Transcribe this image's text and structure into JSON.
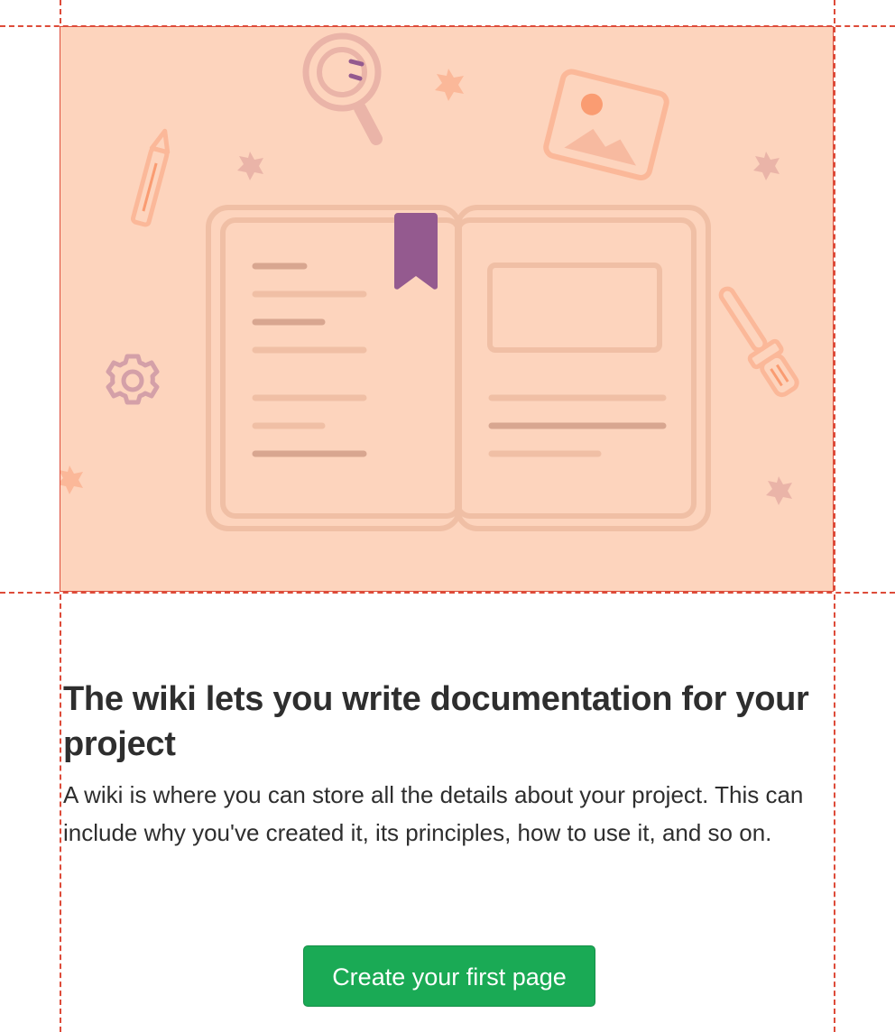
{
  "empty_state": {
    "title": "The wiki lets you write documentation for your project",
    "description": "A wiki is where you can store all the details about your project. This can include why you've created it, its principles, how to use it, and so on.",
    "create_button_label": "Create your first page"
  },
  "colors": {
    "illustration_bg": "#fdd4bd",
    "guide_line": "#dd4b39",
    "button_bg": "#1aaa55",
    "bookmark": "#945a8f"
  },
  "icons": [
    "magnifier-icon",
    "pencil-icon",
    "image-icon",
    "gear-icon",
    "screwdriver-icon",
    "bookmark-icon",
    "open-book-icon",
    "sparkle-icon"
  ]
}
